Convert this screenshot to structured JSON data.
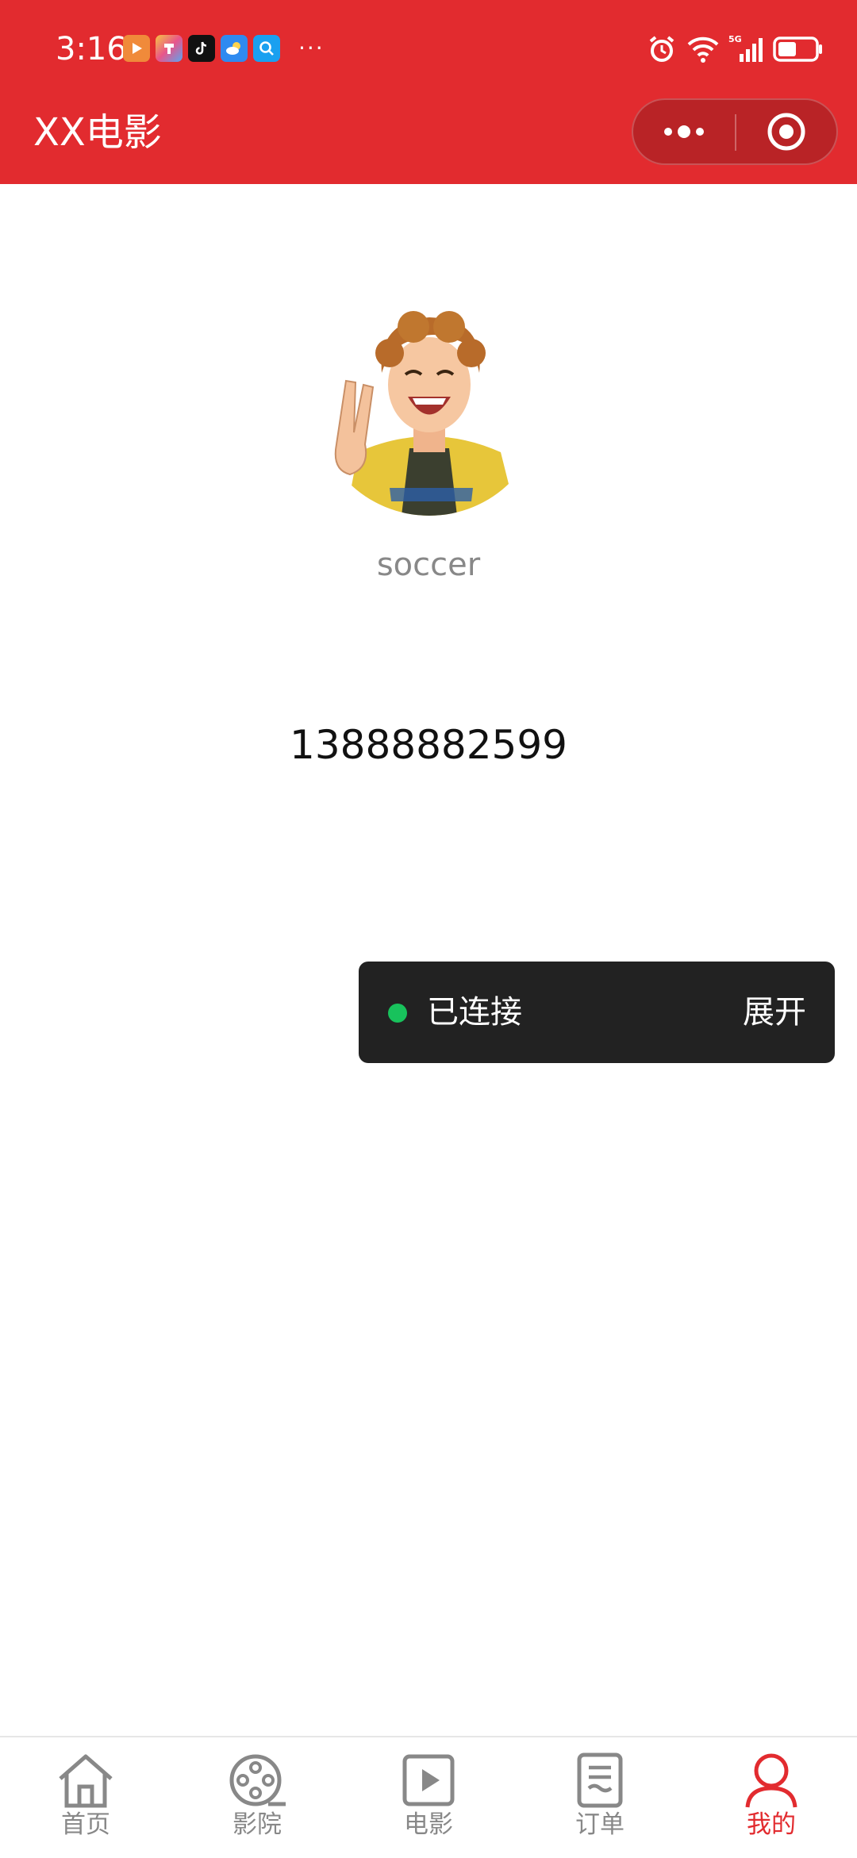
{
  "status_bar": {
    "time": "3:16",
    "notification_icons": [
      "video-app-icon",
      "color-app-icon",
      "tiktok-icon",
      "weather-icon",
      "search-app-icon"
    ],
    "more": "···",
    "battery_level": 0.5
  },
  "header": {
    "title": "XX电影"
  },
  "profile": {
    "username": "soccer",
    "phone": "13888882599"
  },
  "connection": {
    "status": "已连接",
    "expand_label": "展开",
    "dot_color": "#18c25c"
  },
  "tabs": [
    {
      "label": "首页",
      "icon": "home-icon"
    },
    {
      "label": "影院",
      "icon": "film-reel-icon"
    },
    {
      "label": "电影",
      "icon": "play-icon"
    },
    {
      "label": "订单",
      "icon": "order-list-icon"
    },
    {
      "label": "我的",
      "icon": "person-icon"
    }
  ],
  "colors": {
    "brand": "#e22b2f",
    "tab_inactive": "#888888"
  }
}
